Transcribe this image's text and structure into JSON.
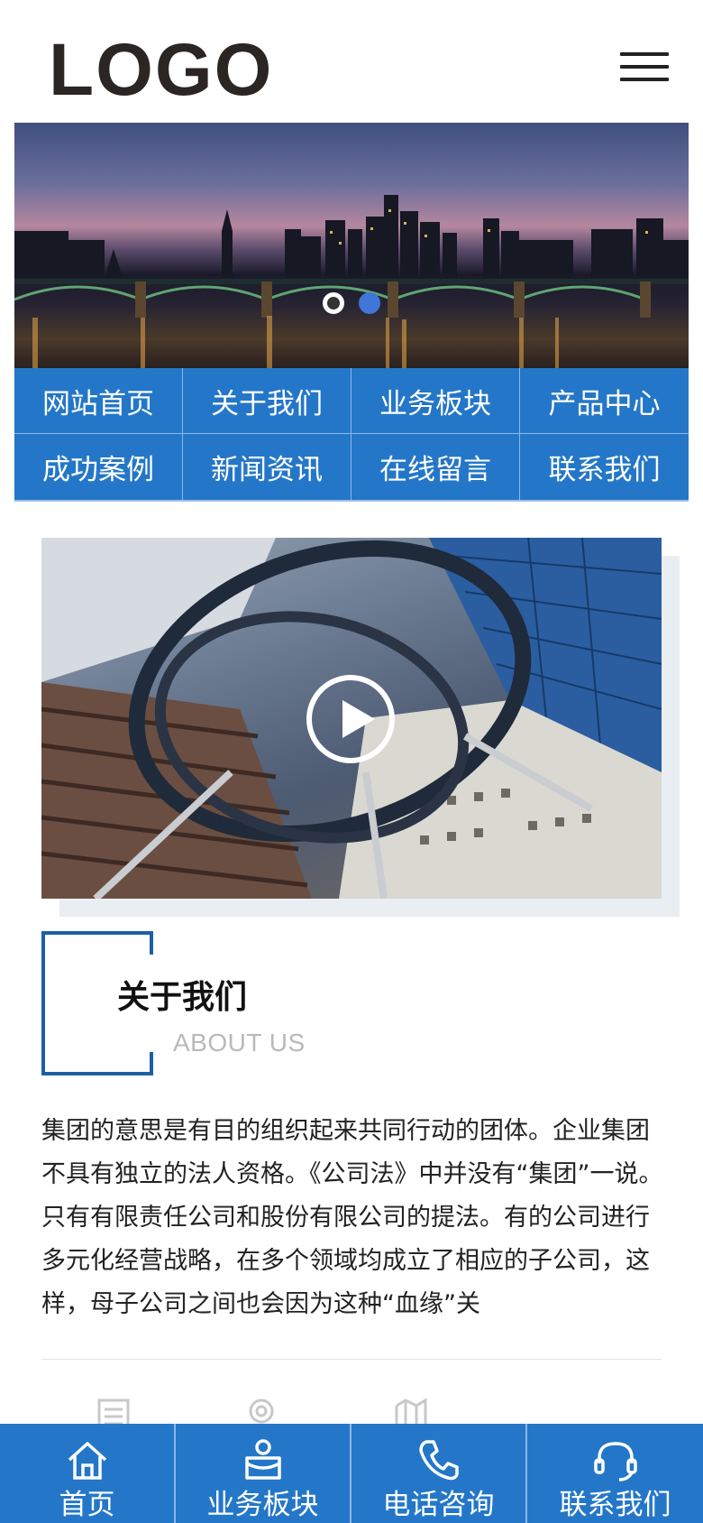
{
  "header": {
    "logo_text": "LOGO",
    "menu_icon": "hamburger-menu-icon"
  },
  "banner": {
    "slide_count": 2,
    "active_slide": 2
  },
  "nav": {
    "items": [
      {
        "label": "网站首页"
      },
      {
        "label": "关于我们"
      },
      {
        "label": "业务板块"
      },
      {
        "label": "产品中心"
      },
      {
        "label": "成功案例"
      },
      {
        "label": "新闻资讯"
      },
      {
        "label": "在线留言"
      },
      {
        "label": "联系我们"
      }
    ]
  },
  "video": {
    "play_icon": "play-icon"
  },
  "about": {
    "title": "关于我们",
    "subtitle": "ABOUT US",
    "text": "集团的意思是有目的组织起来共同行动的团体。企业集团不具有独立的法人资格。《公司法》中并没有“集团”一说。只有有限责任公司和股份有限公司的提法。有的公司进行多元化经营战略，在多个领域均成立了相应的子公司，这样，母子公司之间也会因为这种“血缘”关"
  },
  "bottom_bar": {
    "tabs": [
      {
        "label": "首页",
        "icon": "home-icon"
      },
      {
        "label": "业务板块",
        "icon": "business-icon"
      },
      {
        "label": "电话咨询",
        "icon": "phone-icon"
      },
      {
        "label": "联系我们",
        "icon": "headset-icon"
      }
    ]
  },
  "colors": {
    "primary": "#2477c8",
    "accent_frame": "#1d5fa6",
    "dot_active": "#3f76d7"
  }
}
